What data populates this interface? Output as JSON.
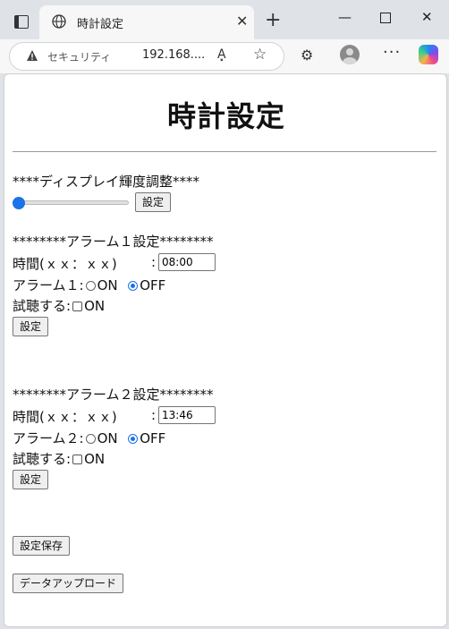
{
  "browser": {
    "tab_title": "時計設定",
    "tab_close": "✕",
    "new_tab": "+",
    "window_controls": {
      "minimize": "—",
      "close": "✕"
    },
    "security_label": "セキュリティ",
    "url": "192.168....",
    "read_aloud": "A͓",
    "favorite": "☆",
    "more": "···",
    "icons": [
      "tab-actions-icon",
      "globe-icon",
      "warning-icon",
      "read-aloud-icon",
      "star-icon",
      "extensions-icon",
      "profile-icon",
      "more-icon",
      "copilot-icon"
    ]
  },
  "page": {
    "title": "時計設定",
    "brightness": {
      "heading": "****ディスプレイ輝度調整****",
      "slider_value": 0,
      "button": "設定"
    },
    "alarm1": {
      "heading": "********アラーム１設定********",
      "time_label": "時間(ｘｘ：ｘｘ)",
      "colon": ":",
      "time_value": "08:00",
      "alarm_label": "アラーム１:",
      "on_label": "ON",
      "off_label": "OFF",
      "selected": "OFF",
      "test_label": "試聴する:",
      "test_on_label": "ON",
      "test_checked": false,
      "button": "設定"
    },
    "alarm2": {
      "heading": "********アラーム２設定********",
      "time_label": "時間(ｘｘ：ｘｘ)",
      "colon": ":",
      "time_value": "13:46",
      "alarm_label": "アラーム２:",
      "on_label": "ON",
      "off_label": "OFF",
      "selected": "OFF",
      "test_label": "試聴する:",
      "test_on_label": "ON",
      "test_checked": false,
      "button": "設定"
    },
    "save_button": "設定保存",
    "upload_button": "データアップロード"
  },
  "colors": {
    "accent": "#1a73e8",
    "chrome_background": "#dfe3e8",
    "page_background": "#ffffff"
  }
}
